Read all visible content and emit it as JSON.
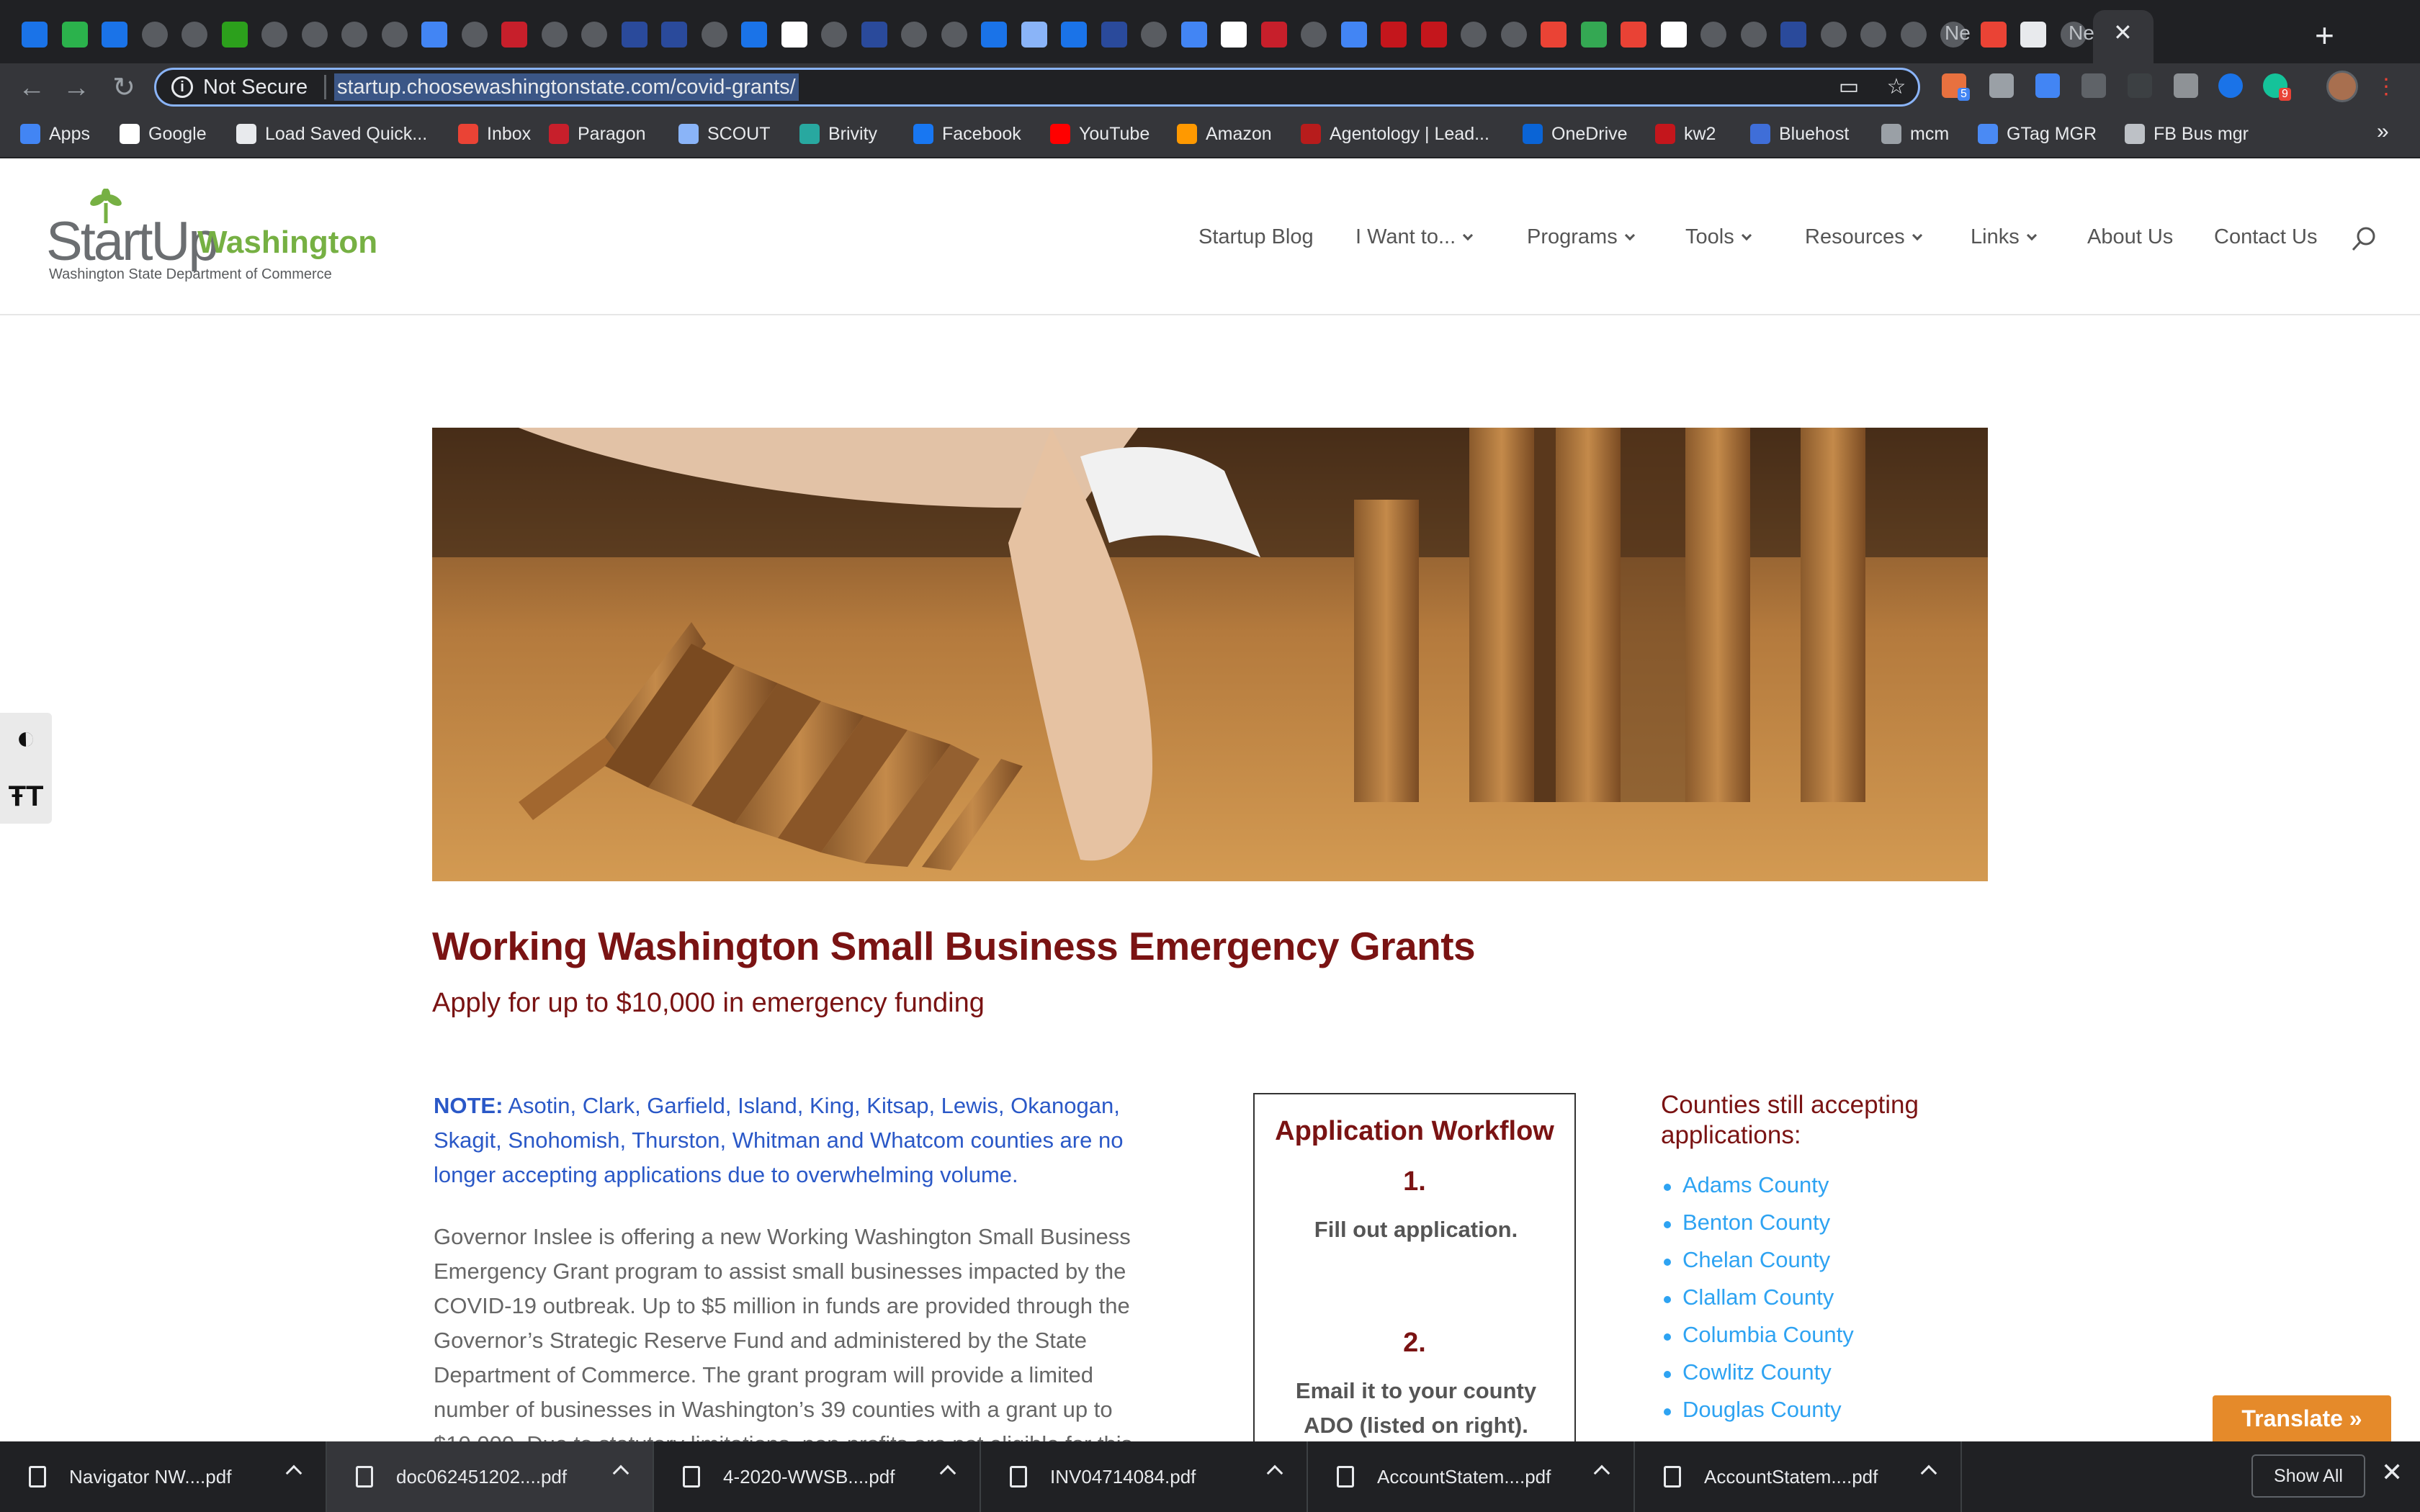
{
  "browser": {
    "tab_labels": [
      "Ne",
      "Ne"
    ],
    "omnibox_security": "Not Secure",
    "url": "startup.choosewashingtonstate.com/covid-grants/",
    "extension_badges": [
      "5",
      "9"
    ],
    "bookmarks": [
      {
        "label": "Apps",
        "icon": "apps-grid-icon",
        "color": "#4285f4"
      },
      {
        "label": "Google",
        "icon": "google-icon",
        "color": "#fff"
      },
      {
        "label": "Load Saved Quick...",
        "icon": "globe-icon",
        "color": "#e8eaed"
      },
      {
        "label": "Inbox",
        "icon": "gmail-icon",
        "color": "#ea4335"
      },
      {
        "label": "Paragon",
        "icon": "paragon-icon",
        "color": "#c71f2b"
      },
      {
        "label": "SCOUT",
        "icon": "scout-icon",
        "color": "#8ab4f8"
      },
      {
        "label": "Brivity",
        "icon": "brivity-icon",
        "color": "#28a8a0"
      },
      {
        "label": "Facebook",
        "icon": "facebook-icon",
        "color": "#1877f2"
      },
      {
        "label": "YouTube",
        "icon": "youtube-icon",
        "color": "#ff0000"
      },
      {
        "label": "Amazon",
        "icon": "amazon-icon",
        "color": "#ff9900"
      },
      {
        "label": "Agentology | Lead...",
        "icon": "agentology-icon",
        "color": "#b71c1c"
      },
      {
        "label": "OneDrive",
        "icon": "onedrive-icon",
        "color": "#0a64d6"
      },
      {
        "label": "kw2",
        "icon": "kw-icon",
        "color": "#c4161c"
      },
      {
        "label": "Bluehost",
        "icon": "bluehost-icon",
        "color": "#3f6ed8"
      },
      {
        "label": "mcm",
        "icon": "mcm-icon",
        "color": "#9aa0a6"
      },
      {
        "label": "GTag MGR",
        "icon": "gtag-icon",
        "color": "#4a8af4"
      },
      {
        "label": "FB Bus mgr",
        "icon": "fb-business-icon",
        "color": "#bdc1c6"
      }
    ],
    "more_bookmarks": "»"
  },
  "site": {
    "logo_startup": "StartUp",
    "logo_washington": "Washington",
    "logo_dept": "Washington State Department of Commerce",
    "menu": [
      {
        "label": "Startup Blog",
        "dropdown": false
      },
      {
        "label": "I Want to...",
        "dropdown": true
      },
      {
        "label": "Programs",
        "dropdown": true
      },
      {
        "label": "Tools",
        "dropdown": true
      },
      {
        "label": "Resources",
        "dropdown": true
      },
      {
        "label": "Links",
        "dropdown": true
      },
      {
        "label": "About Us",
        "dropdown": false
      },
      {
        "label": "Contact Us",
        "dropdown": false
      }
    ]
  },
  "accessibility": {
    "contrast": "◐",
    "text_size": "ŦT"
  },
  "content": {
    "title": "Working Washington Small Business Emergency Grants",
    "subtitle": "Apply for up to $10,000 in emergency funding",
    "note_label": "NOTE:",
    "note_text": "Asotin, Clark, Garfield, Island, King, Kitsap, Lewis, Okanogan, Skagit, Snohomish, Thurston, Whitman and Whatcom counties are no longer accepting applications due to overwhelming volume.",
    "body": "Governor Inslee is offering a new Working Washington Small Business Emergency Grant program to assist small businesses impacted by the COVID-19 outbreak. Up to $5 million in funds are provided through the Governor’s Strategic Reserve Fund and administered by the State Department of Commerce. The grant program will provide a limited number of businesses in Washington’s 39 counties with a grant up to $10,000. Due to statutory limitations, non-profits are not eligible for this"
  },
  "workflow": {
    "title": "Application Workflow",
    "steps": [
      {
        "number": "1.",
        "text": "Fill out application."
      },
      {
        "number": "2.",
        "text": "Email it to your county ADO (listed on right)."
      }
    ]
  },
  "counties": {
    "title": "Counties still accepting applications:",
    "items": [
      "Adams County",
      "Benton County",
      "Chelan County",
      "Clallam County",
      "Columbia County",
      "Cowlitz County",
      "Douglas County"
    ]
  },
  "translate_label": "Translate »",
  "downloads": {
    "items": [
      "Navigator NW....pdf",
      "doc062451202....pdf",
      "4-2020-WWSB....pdf",
      "INV04714084.pdf",
      "AccountStatem....pdf",
      "AccountStatem....pdf"
    ],
    "show_all": "Show All",
    "close": "✕"
  }
}
